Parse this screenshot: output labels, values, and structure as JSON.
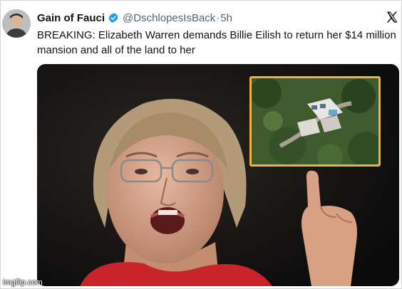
{
  "tweet": {
    "author_name": "Gain of Fauci",
    "author_handle": "@DschlopesIsBack",
    "separator": "·",
    "timestamp": "5h",
    "text": "BREAKING: Elizabeth Warren demands Billie Eilish to return her $14 million mansion and all of the land to her",
    "icons": {
      "verified": "verified-badge-icon",
      "platform": "x-logo-icon"
    }
  },
  "colors": {
    "verified_blue": "#1d9bf0",
    "inset_border": "#f2b233",
    "text_primary": "#0f1419",
    "text_secondary": "#536471"
  },
  "watermark": "imgflip.com"
}
